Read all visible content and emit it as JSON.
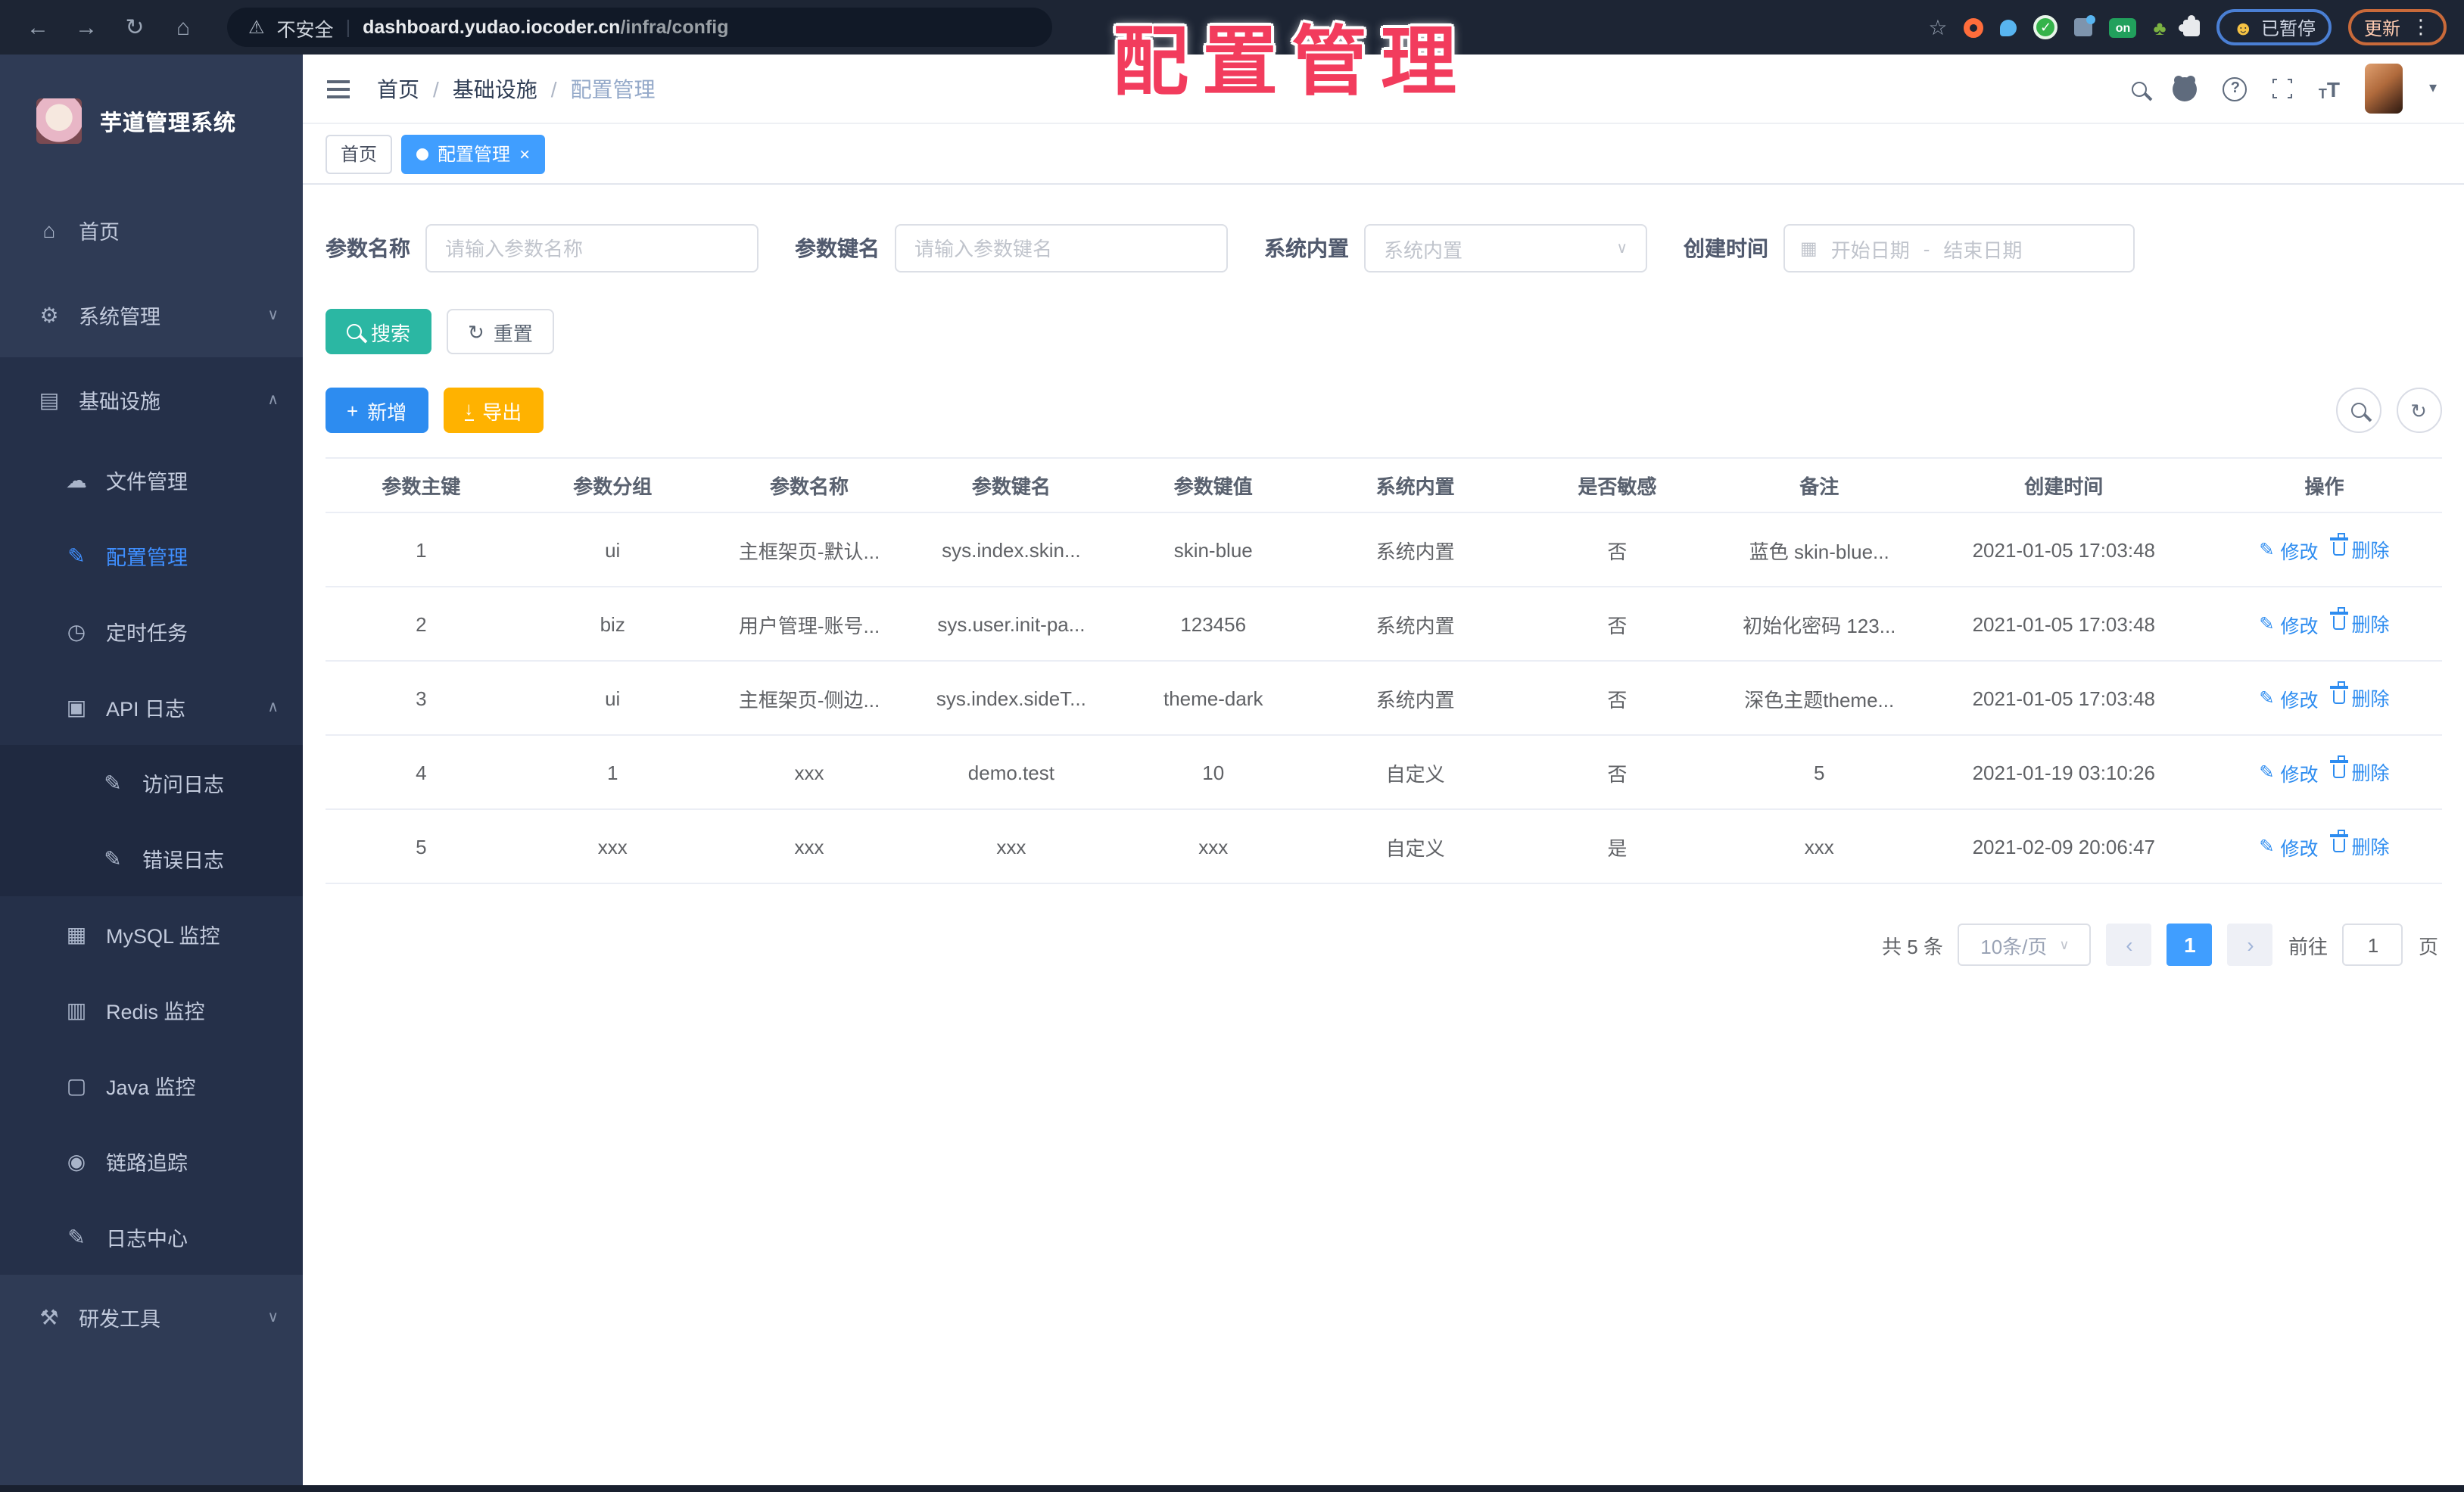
{
  "browser": {
    "security_label": "不安全",
    "url_host": "dashboard.yudao.iocoder.cn",
    "url_path": "/infra/config",
    "divider": "|",
    "paused_label": "已暂停",
    "update_label": "更新",
    "ext_on_label": "on",
    "ext_check_label": "✓"
  },
  "icons": {
    "back": "←",
    "forward": "→",
    "reload": "↻",
    "home": "⌂",
    "warning": "⚠",
    "star": "☆",
    "menu_dots": "⋮",
    "smiley": "☻",
    "plant": "♣",
    "crumb_sep": "/",
    "chevron_down": "∨",
    "chevron_up": "∧",
    "caret_down": "▾",
    "menu_home": "⌂",
    "menu_gear": "⚙",
    "menu_infra": "▤",
    "menu_cloud": "☁",
    "menu_edit": "✎",
    "menu_timer": "◷",
    "menu_api": "▣",
    "menu_log": "✎",
    "menu_mysql": "▦",
    "menu_redis": "▥",
    "menu_java": "▢",
    "menu_trace": "◉",
    "menu_tools": "⚒",
    "calendar": "▦",
    "date_sep": "-",
    "plus": "+",
    "download": "↓",
    "refresh": "↻",
    "help": "?",
    "fontsize_small": "T",
    "fontsize_big": "T",
    "prev": "‹",
    "next": "›",
    "close": "×",
    "pen": "✎"
  },
  "annotation": {
    "text": "配置管理"
  },
  "sidebar": {
    "title": "芋道管理系统",
    "items": [
      {
        "label": "首页"
      },
      {
        "label": "系统管理"
      },
      {
        "label": "基础设施"
      },
      {
        "label": "文件管理"
      },
      {
        "label": "配置管理"
      },
      {
        "label": "定时任务"
      },
      {
        "label": "API 日志"
      },
      {
        "label": "访问日志"
      },
      {
        "label": "错误日志"
      },
      {
        "label": "MySQL 监控"
      },
      {
        "label": "Redis 监控"
      },
      {
        "label": "Java 监控"
      },
      {
        "label": "链路追踪"
      },
      {
        "label": "日志中心"
      },
      {
        "label": "研发工具"
      }
    ]
  },
  "header": {
    "breadcrumb": [
      "首页",
      "基础设施",
      "配置管理"
    ]
  },
  "tabs": [
    {
      "label": "首页"
    },
    {
      "label": "配置管理"
    }
  ],
  "filters": {
    "name_label": "参数名称",
    "name_placeholder": "请输入参数名称",
    "key_label": "参数键名",
    "key_placeholder": "请输入参数键名",
    "type_label": "系统内置",
    "type_placeholder": "系统内置",
    "time_label": "创建时间",
    "start_placeholder": "开始日期",
    "end_placeholder": "结束日期",
    "search_label": "搜索",
    "reset_label": "重置"
  },
  "toolbar": {
    "add_label": "新增",
    "export_label": "导出"
  },
  "table": {
    "headers": [
      "参数主键",
      "参数分组",
      "参数名称",
      "参数键名",
      "参数键值",
      "系统内置",
      "是否敏感",
      "备注",
      "创建时间",
      "操作"
    ],
    "edit_label": "修改",
    "delete_label": "删除",
    "rows": [
      {
        "cells": [
          "1",
          "ui",
          "主框架页-默认...",
          "sys.index.skin...",
          "skin-blue",
          "系统内置",
          "否",
          "蓝色 skin-blue...",
          "2021-01-05 17:03:48"
        ]
      },
      {
        "cells": [
          "2",
          "biz",
          "用户管理-账号...",
          "sys.user.init-pa...",
          "123456",
          "系统内置",
          "否",
          "初始化密码 123...",
          "2021-01-05 17:03:48"
        ]
      },
      {
        "cells": [
          "3",
          "ui",
          "主框架页-侧边...",
          "sys.index.sideT...",
          "theme-dark",
          "系统内置",
          "否",
          "深色主题theme...",
          "2021-01-05 17:03:48"
        ]
      },
      {
        "cells": [
          "4",
          "1",
          "xxx",
          "demo.test",
          "10",
          "自定义",
          "否",
          "5",
          "2021-01-19 03:10:26"
        ]
      },
      {
        "cells": [
          "5",
          "xxx",
          "xxx",
          "xxx",
          "xxx",
          "自定义",
          "是",
          "xxx",
          "2021-02-09 20:06:47"
        ]
      }
    ]
  },
  "pagination": {
    "total": "共 5 条",
    "page_size": "10条/页",
    "current": "1",
    "goto_label": "前往",
    "goto_value": "1",
    "page_label": "页"
  }
}
